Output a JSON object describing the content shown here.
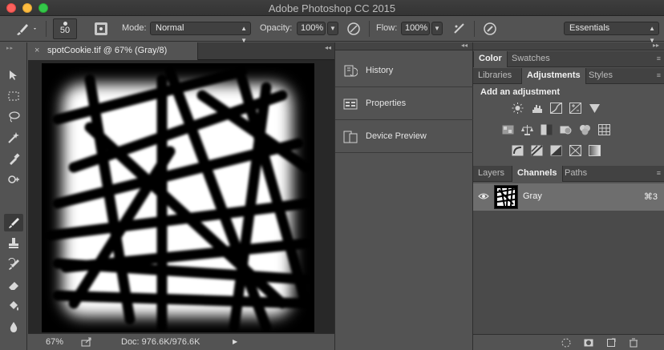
{
  "app": {
    "title": "Adobe Photoshop CC 2015"
  },
  "options_bar": {
    "brush_size": "50",
    "mode_label": "Mode:",
    "mode_value": "Normal",
    "opacity_label": "Opacity:",
    "opacity_value": "100%",
    "flow_label": "Flow:",
    "flow_value": "100%",
    "workspace": "Essentials"
  },
  "document": {
    "tab_title": "spotCookie.tif @ 67% (Gray/8)",
    "close_glyph": "×",
    "zoom": "67%",
    "doc_size": "Doc: 976.6K/976.6K"
  },
  "tools": [
    {
      "name": "move-tool"
    },
    {
      "name": "marquee-tool"
    },
    {
      "name": "lasso-tool"
    },
    {
      "name": "magic-wand-tool"
    },
    {
      "name": "eyedropper-tool"
    },
    {
      "name": "healing-brush-tool"
    },
    {
      "name": "brush-tool",
      "active": true
    },
    {
      "name": "clone-stamp-tool"
    },
    {
      "name": "history-brush-tool"
    },
    {
      "name": "eraser-tool"
    },
    {
      "name": "paint-bucket-tool"
    },
    {
      "name": "blur-tool"
    }
  ],
  "collapsed_panels": [
    {
      "label": "History",
      "icon": "history-icon"
    },
    {
      "label": "Properties",
      "icon": "properties-icon"
    },
    {
      "label": "Device Preview",
      "icon": "device-preview-icon"
    }
  ],
  "right_panel": {
    "group1_tabs": [
      "Color",
      "Swatches"
    ],
    "group1_active": "Color",
    "group2_tabs": [
      "Libraries",
      "Adjustments",
      "Styles"
    ],
    "group2_active": "Adjustments",
    "add_adjustment_label": "Add an adjustment",
    "group3_tabs": [
      "Layers",
      "Channels",
      "Paths"
    ],
    "group3_active": "Channels",
    "channel": {
      "name": "Gray",
      "shortcut": "⌘3"
    }
  }
}
